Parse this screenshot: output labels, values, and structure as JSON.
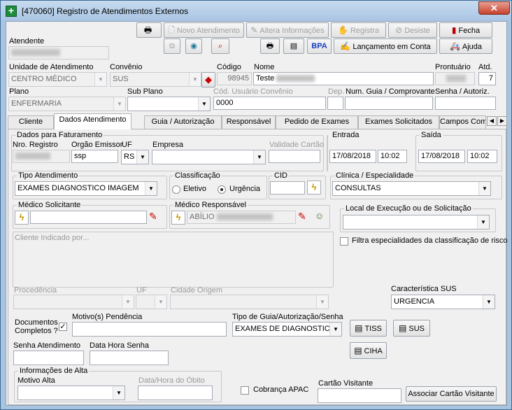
{
  "window": {
    "title": "[470060]  Registro de Atendimentos Externos",
    "close": "✕"
  },
  "toolbar": {
    "novo": "Novo Atendimento",
    "altera": "Altera Informações",
    "registra": "Registra",
    "desiste": "Desiste",
    "fecha": "Fecha",
    "bpa": "BPA",
    "lancamento": "Lançamento em Conta",
    "ajuda": "Ajuda"
  },
  "header": {
    "atendente_label": "Atendente",
    "unidade_label": "Unidade de Atendimento",
    "unidade_value": "CENTRO MÉDICO",
    "convenio_label": "Convênio",
    "convenio_value": "SUS",
    "codigo_label": "Código",
    "codigo_value": "98945",
    "nome_label": "Nome",
    "nome_value": "Teste",
    "prontuario_label": "Prontuário",
    "atd_label": "Atd.",
    "atd_value": "7",
    "plano_label": "Plano",
    "plano_value": "ENFERMARIA",
    "subplano_label": "Sub Plano",
    "codusuario_label": "Cód. Usuário Convênio",
    "codusuario_value": "0000",
    "dep_label": "Dep.",
    "numguia_label": "Num. Guia / Comprovante",
    "senha_label": "Senha / Autoriz."
  },
  "tabs": [
    "Cliente",
    "Dados Atendimento",
    "Guia / Autorização",
    "Responsável",
    "Pedido de Exames",
    "Exames Solicitados",
    "Campos Com"
  ],
  "faturamento": {
    "caption": "Dados para Faturamento",
    "nro_label": "Nro. Registro",
    "orgao_label": "Orgão Emissor",
    "orgao_value": "ssp",
    "uf_label": "UF",
    "uf_value": "RS",
    "empresa_label": "Empresa",
    "validade_label": "Validade Cartão"
  },
  "entrada": {
    "caption": "Entrada",
    "date": "17/08/2018",
    "time": "10:02"
  },
  "saida": {
    "caption": "Saída",
    "date": "17/08/2018",
    "time": "10:02"
  },
  "tipo_atendimento": {
    "caption": "Tipo Atendimento",
    "value": "EXAMES DIAGNOSTICO IMAGEM"
  },
  "classificacao": {
    "caption": "Classificação",
    "eletivo": "Eletivo",
    "urgencia": "Urgência"
  },
  "cid": {
    "caption": "CID"
  },
  "clinica": {
    "caption": "Clínica / Especialidade",
    "value": "CONSULTAS"
  },
  "medico_solicitante": {
    "caption": "Médico Solicitante"
  },
  "medico_responsavel": {
    "caption": "Médico Responsável",
    "value": "ABÍLIO"
  },
  "local_execucao": {
    "caption": "Local de Execução ou de Solicitação"
  },
  "cliente_indicado": {
    "caption": "Cliente Indicado por..."
  },
  "filtra": "Filtra especialidades da classificação de risco",
  "procedencia": {
    "procedencia_label": "Procedência",
    "uf_label": "UF",
    "cidade_label": "Cidade Origem"
  },
  "caracteristica": {
    "label": "Característica SUS",
    "value": "URGENCIA"
  },
  "documentos": {
    "label1": "Documentos",
    "label2": "Completos ?",
    "check": "✓"
  },
  "motivo_pendencia": {
    "label": "Motivo(s) Pendência"
  },
  "tipo_guia": {
    "label": "Tipo de Guia/Autorização/Senha",
    "value": "EXAMES DE DIAGNOSTICO"
  },
  "buttons": {
    "tiss": "TISS",
    "sus": "SUS",
    "ciha": "CIHA"
  },
  "senha_atendimento": {
    "label": "Senha Atendimento"
  },
  "data_hora_senha": {
    "label": "Data Hora Senha"
  },
  "alta": {
    "caption": "Informações de Alta",
    "motivo_label": "Motivo Alta",
    "obito_label": "Data/Hora do Óbito"
  },
  "cobranca_apac": "Cobrança APAC",
  "cartao_visitante": {
    "label": "Cartão Visitante",
    "button": "Associar Cartão Visitante"
  }
}
